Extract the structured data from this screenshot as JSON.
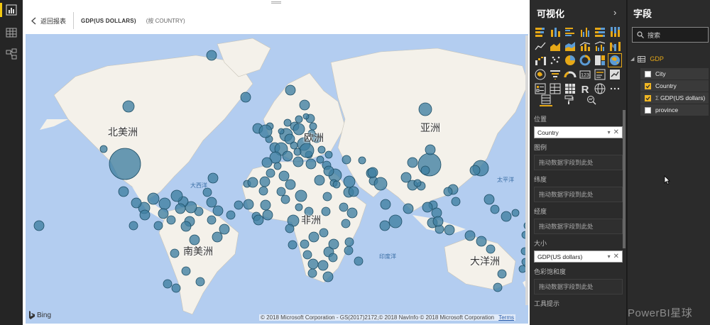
{
  "header": {
    "back_label": "返回报表",
    "visual_title": "GDP(US DOLLARS)",
    "visual_subtitle": "(按 COUNTRY)"
  },
  "map": {
    "continents": {
      "north_america": "北美洲",
      "asia": "亚洲",
      "europe": "欧洲",
      "africa": "非洲",
      "south_america": "南美洲",
      "oceania": "大洋洲"
    },
    "oceans": {
      "atlantic": "大西洋",
      "pacific": "太平洋",
      "indian": "印度洋"
    },
    "bing_label": "Bing",
    "copyright": "© 2018 Microsoft Corporation - GS(2017)2172,© 2018 NavInfo © 2018 Microsoft Corporation",
    "terms": "Terms",
    "bubble_color": "#3f7fa0",
    "water_color": "#b3cdf0",
    "land_color": "#f4f1ea"
  },
  "visualizations": {
    "title": "可视化",
    "icons": [
      "stacked-bar-icon",
      "stacked-column-icon",
      "clustered-bar-icon",
      "clustered-column-icon",
      "100-bar-icon",
      "100-column-icon",
      "line-chart-icon",
      "area-chart-icon",
      "stacked-area-icon",
      "line-column-icon",
      "line-clustered-icon",
      "ribbon-chart-icon",
      "waterfall-icon",
      "scatter-icon",
      "pie-chart-icon",
      "donut-chart-icon",
      "treemap-icon",
      "map-icon",
      "filled-map-icon",
      "funnel-icon",
      "gauge-icon",
      "card-icon",
      "multirow-card-icon",
      "kpi-icon",
      "slicer-icon",
      "table-icon",
      "matrix-icon",
      "r-visual-icon",
      "globe-icon",
      "more-icon"
    ],
    "selected_icon": "map-icon",
    "wells": [
      {
        "label": "位置",
        "field": "Country"
      },
      {
        "label": "图例",
        "placeholder": "拖动数据字段到此处"
      },
      {
        "label": "纬度",
        "placeholder": "拖动数据字段到此处"
      },
      {
        "label": "经度",
        "placeholder": "拖动数据字段到此处"
      },
      {
        "label": "大小",
        "field": "GDP(US dollars)"
      },
      {
        "label": "色彩饱和度",
        "placeholder": "拖动数据字段到此处"
      },
      {
        "label": "工具提示"
      }
    ]
  },
  "fields": {
    "title": "字段",
    "search_placeholder": "搜索",
    "table_name": "GDP",
    "items": [
      {
        "name": "City",
        "checked": false
      },
      {
        "name": "Country",
        "checked": true
      },
      {
        "name": "GDP(US dollars)",
        "checked": true
      },
      {
        "name": "province",
        "checked": false
      }
    ],
    "accent_color": "#e6a817"
  },
  "watermark": "PowerBI星球"
}
